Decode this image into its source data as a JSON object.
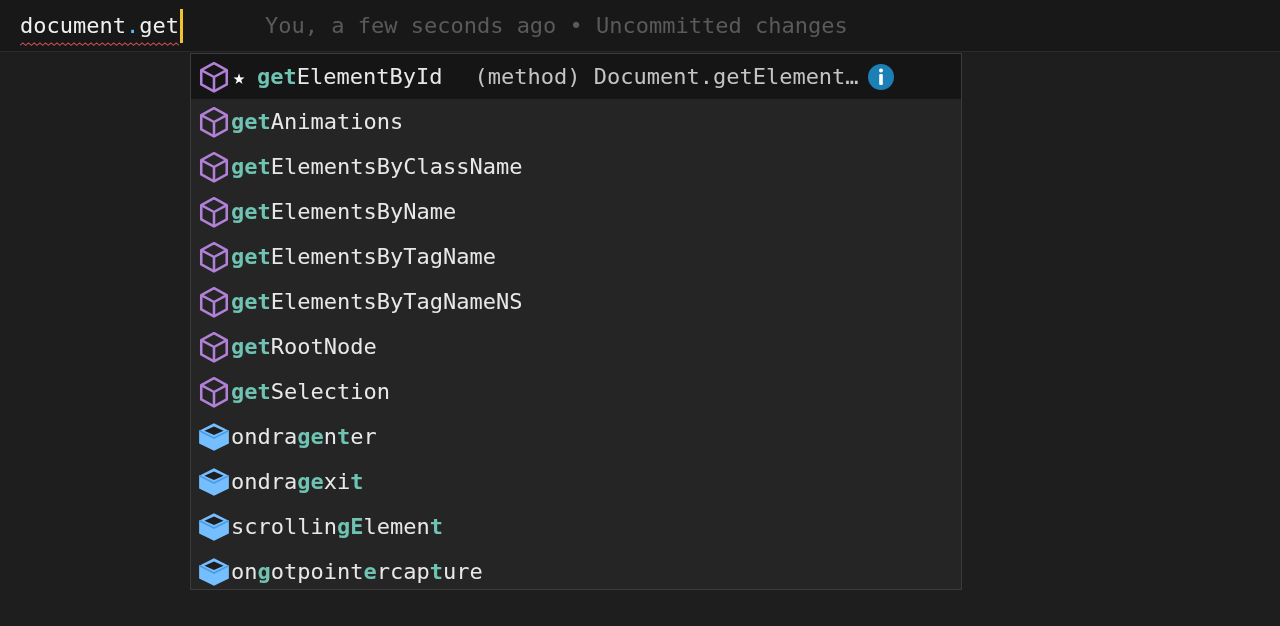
{
  "editor": {
    "line_text": [
      {
        "text": "document",
        "kind": "ident"
      },
      {
        "text": ".",
        "kind": "punct"
      },
      {
        "text": "get",
        "kind": "ident"
      }
    ],
    "error": true,
    "blame": "You, a few seconds ago • Uncommitted changes"
  },
  "suggestions": [
    {
      "kind": "method",
      "selected": true,
      "star": "★",
      "segments": [
        {
          "text": "get",
          "match": true
        },
        {
          "text": "ElementById",
          "match": false
        }
      ],
      "detail": "(method) Document.getElement…"
    },
    {
      "kind": "method",
      "selected": false,
      "segments": [
        {
          "text": "get",
          "match": true
        },
        {
          "text": "Animations",
          "match": false
        }
      ]
    },
    {
      "kind": "method",
      "selected": false,
      "segments": [
        {
          "text": "get",
          "match": true
        },
        {
          "text": "ElementsByClassName",
          "match": false
        }
      ]
    },
    {
      "kind": "method",
      "selected": false,
      "segments": [
        {
          "text": "get",
          "match": true
        },
        {
          "text": "ElementsByName",
          "match": false
        }
      ]
    },
    {
      "kind": "method",
      "selected": false,
      "segments": [
        {
          "text": "get",
          "match": true
        },
        {
          "text": "ElementsByTagName",
          "match": false
        }
      ]
    },
    {
      "kind": "method",
      "selected": false,
      "segments": [
        {
          "text": "get",
          "match": true
        },
        {
          "text": "ElementsByTagNameNS",
          "match": false
        }
      ]
    },
    {
      "kind": "method",
      "selected": false,
      "segments": [
        {
          "text": "get",
          "match": true
        },
        {
          "text": "RootNode",
          "match": false
        }
      ]
    },
    {
      "kind": "method",
      "selected": false,
      "segments": [
        {
          "text": "get",
          "match": true
        },
        {
          "text": "Selection",
          "match": false
        }
      ]
    },
    {
      "kind": "property",
      "selected": false,
      "segments": [
        {
          "text": "ondra",
          "match": false
        },
        {
          "text": "ge",
          "match": true
        },
        {
          "text": "n",
          "match": false
        },
        {
          "text": "t",
          "match": true
        },
        {
          "text": "er",
          "match": false
        }
      ]
    },
    {
      "kind": "property",
      "selected": false,
      "segments": [
        {
          "text": "ondra",
          "match": false
        },
        {
          "text": "ge",
          "match": true
        },
        {
          "text": "xi",
          "match": false
        },
        {
          "text": "t",
          "match": true
        }
      ]
    },
    {
      "kind": "property",
      "selected": false,
      "segments": [
        {
          "text": "scrollin",
          "match": false
        },
        {
          "text": "gE",
          "match": true
        },
        {
          "text": "lemen",
          "match": false
        },
        {
          "text": "t",
          "match": true
        }
      ]
    },
    {
      "kind": "property",
      "selected": false,
      "segments": [
        {
          "text": "on",
          "match": false
        },
        {
          "text": "g",
          "match": true
        },
        {
          "text": "otpoint",
          "match": false
        },
        {
          "text": "e",
          "match": true
        },
        {
          "text": "rcap",
          "match": false
        },
        {
          "text": "t",
          "match": true
        },
        {
          "text": "ure",
          "match": false
        }
      ]
    }
  ]
}
